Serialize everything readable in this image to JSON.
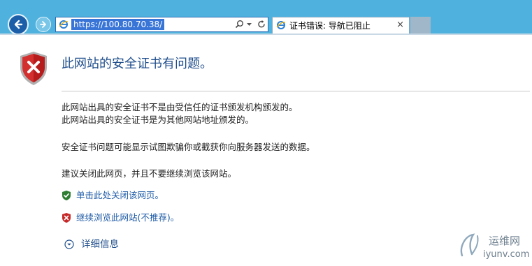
{
  "browser": {
    "address_bar": {
      "url": "https://100.80.70.38/",
      "search_icon": "search-icon",
      "dropdown_icon": "chevron-down-icon",
      "refresh_icon": "refresh-icon"
    },
    "tab": {
      "title": "证书错误: 导航已阻止",
      "close_label": "×"
    },
    "colors": {
      "chrome": "#4fb2de",
      "link": "#1d5aa6",
      "title": "#1f4e8c",
      "danger": "#c62828",
      "safe": "#2e7d32"
    }
  },
  "page": {
    "title": "此网站的安全证书有问题。",
    "lines": {
      "line1": "此网站出具的安全证书不是由受信任的证书颁发机构颁发的。",
      "line2": "此网站出具的安全证书是为其他网站地址颁发的。",
      "line3": "安全证书问题可能显示试图欺骗你或截获你向服务器发送的数据。",
      "line4": "建议关闭此网页，并且不要继续浏览该网站。"
    },
    "links": {
      "close_page": "单击此处关闭该网页。",
      "continue": "继续浏览此网站(不推荐)。"
    },
    "details": "详细信息"
  },
  "watermark": {
    "cn": "运维网",
    "en": "iyunv.com"
  }
}
